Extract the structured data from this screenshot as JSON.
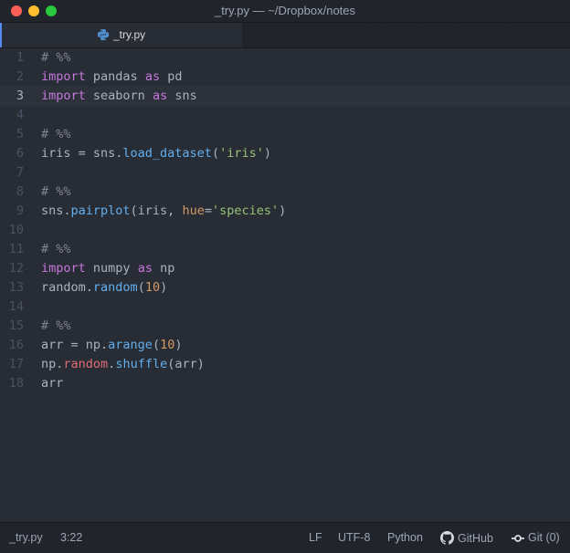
{
  "window": {
    "title": "_try.py — ~/Dropbox/notes"
  },
  "tab": {
    "label": "_try.py",
    "icon": "python-icon"
  },
  "editor": {
    "active_line": 3,
    "lines": [
      [
        {
          "t": "# %%",
          "c": "cm"
        }
      ],
      [
        {
          "t": "import",
          "c": "kw"
        },
        {
          "t": " pandas "
        },
        {
          "t": "as",
          "c": "kw"
        },
        {
          "t": " pd"
        }
      ],
      [
        {
          "t": "import",
          "c": "kw"
        },
        {
          "t": " seaborn "
        },
        {
          "t": "as",
          "c": "kw"
        },
        {
          "t": " sns"
        }
      ],
      [],
      [
        {
          "t": "# %%",
          "c": "cm"
        }
      ],
      [
        {
          "t": "iris = sns."
        },
        {
          "t": "load_dataset",
          "c": "fn"
        },
        {
          "t": "("
        },
        {
          "t": "'iris'",
          "c": "st"
        },
        {
          "t": ")"
        }
      ],
      [],
      [
        {
          "t": "# %%",
          "c": "cm"
        }
      ],
      [
        {
          "t": "sns."
        },
        {
          "t": "pairplot",
          "c": "fn"
        },
        {
          "t": "(iris, "
        },
        {
          "t": "hue",
          "c": "at"
        },
        {
          "t": "="
        },
        {
          "t": "'species'",
          "c": "st"
        },
        {
          "t": ")"
        }
      ],
      [],
      [
        {
          "t": "# %%",
          "c": "cm"
        }
      ],
      [
        {
          "t": "import",
          "c": "kw"
        },
        {
          "t": " numpy "
        },
        {
          "t": "as",
          "c": "kw"
        },
        {
          "t": " np"
        }
      ],
      [
        {
          "t": "random."
        },
        {
          "t": "random",
          "c": "fn"
        },
        {
          "t": "("
        },
        {
          "t": "10",
          "c": "nm"
        },
        {
          "t": ")"
        }
      ],
      [],
      [
        {
          "t": "# %%",
          "c": "cm"
        }
      ],
      [
        {
          "t": "arr = np."
        },
        {
          "t": "arange",
          "c": "fn"
        },
        {
          "t": "("
        },
        {
          "t": "10",
          "c": "nm"
        },
        {
          "t": ")"
        }
      ],
      [
        {
          "t": "np."
        },
        {
          "t": "random",
          "c": "pr"
        },
        {
          "t": "."
        },
        {
          "t": "shuffle",
          "c": "fn"
        },
        {
          "t": "(arr)"
        }
      ],
      [
        {
          "t": "arr"
        }
      ]
    ]
  },
  "statusbar": {
    "file": "_try.py",
    "cursor": "3:22",
    "line_ending": "LF",
    "encoding": "UTF-8",
    "grammar": "Python",
    "github": "GitHub",
    "git": "Git (0)"
  },
  "colors": {
    "keyword": "#c678dd",
    "function": "#61afef",
    "string": "#98c379",
    "number": "#d19a66",
    "comment": "#7f848e",
    "property": "#e06c75",
    "tab_accent": "#568af2"
  }
}
